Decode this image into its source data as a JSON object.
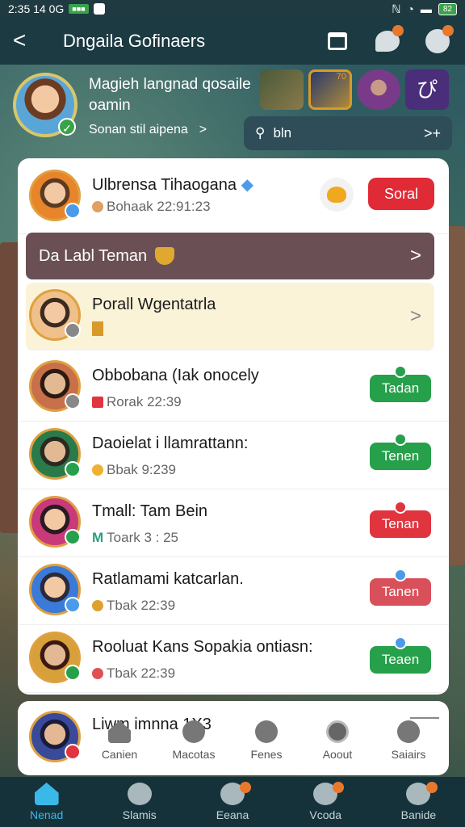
{
  "status_bar": {
    "time": "2:35 14 0G",
    "badge": "■■■",
    "battery": "82"
  },
  "header": {
    "title": "Dngaila Gofinaers",
    "back": "<"
  },
  "profile": {
    "name": "Magieh langnad qosaile oamin",
    "link": "Sonan stil aipena",
    "link_arrow": ">",
    "thumb2_number": "70",
    "thumb4_glyph": "ぴ",
    "search_text": "bln",
    "search_arrow": ">+"
  },
  "top_row": {
    "name": "Ulbrensa Tihaogana",
    "sub": "Bohaak 22:91:23",
    "sort_label": "Soral"
  },
  "section": {
    "label": "Da Labl Teman",
    "chevron": ">"
  },
  "highlight_row": {
    "name": "Porall Wgentatrla",
    "chevron": ">"
  },
  "rows": [
    {
      "name": "Obbobana (Iak onocely",
      "sub": "Rorak 22:39",
      "button": "Tadan",
      "color": "#26a04a"
    },
    {
      "name": "Daoielat i llamrattann:",
      "sub": "Bbak 9:239",
      "button": "Tenen",
      "color": "#26a04a"
    },
    {
      "name": "Tmall: Tam Bein",
      "sub": "Toark 3 : 25",
      "button": "Tenan",
      "color": "#e0343f"
    },
    {
      "name": "Ratlamami katcarlan.",
      "sub": "Tbak 22:39",
      "button": "Tanen",
      "color": "#e0343f"
    },
    {
      "name": "Rooluat Kans Sopakia ontiasn:",
      "sub": "Tbak 22:39",
      "button": "Teaen",
      "color": "#26a04a"
    }
  ],
  "mini": {
    "name": "Liwm imnna 1X3",
    "quick": [
      "Canien",
      "Macotas",
      "Fenes",
      "Aoout",
      "Saiairs"
    ]
  },
  "bottom_nav": [
    "Nenad",
    "Slamis",
    "Eeana",
    "Vcoda",
    "Banide"
  ]
}
